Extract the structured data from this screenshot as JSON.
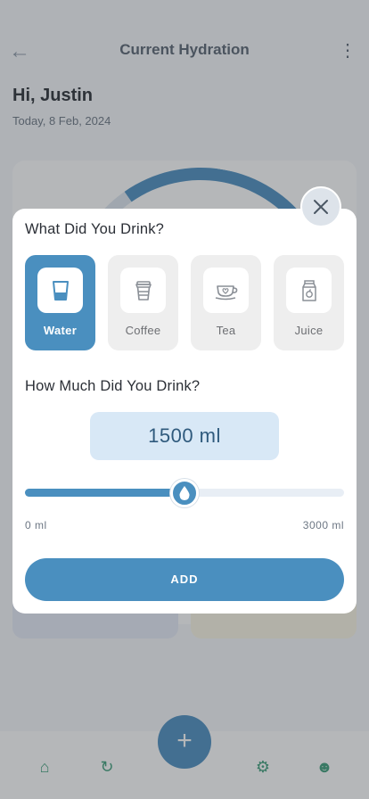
{
  "background": {
    "header_title": "Current Hydration",
    "greeting": "Hi, Justin",
    "date": "Today, 8 Feb, 2024"
  },
  "modal": {
    "drink_question": "What Did You Drink?",
    "drinks": [
      {
        "label": "Water",
        "icon": "water-glass-icon",
        "selected": true
      },
      {
        "label": "Coffee",
        "icon": "coffee-cup-icon",
        "selected": false
      },
      {
        "label": "Tea",
        "icon": "tea-cup-icon",
        "selected": false
      },
      {
        "label": "Juice",
        "icon": "juice-carton-icon",
        "selected": false
      }
    ],
    "amount_question": "How Much Did You Drink?",
    "amount_display": "1500 ml",
    "slider": {
      "value": 1500,
      "min": 0,
      "max": 3000,
      "min_label": "0 ml",
      "max_label": "3000 ml"
    },
    "add_label": "ADD"
  },
  "colors": {
    "accent": "#4a8fbf",
    "amount_bg": "#d8e8f6",
    "tile_bg": "#eeeeee"
  }
}
